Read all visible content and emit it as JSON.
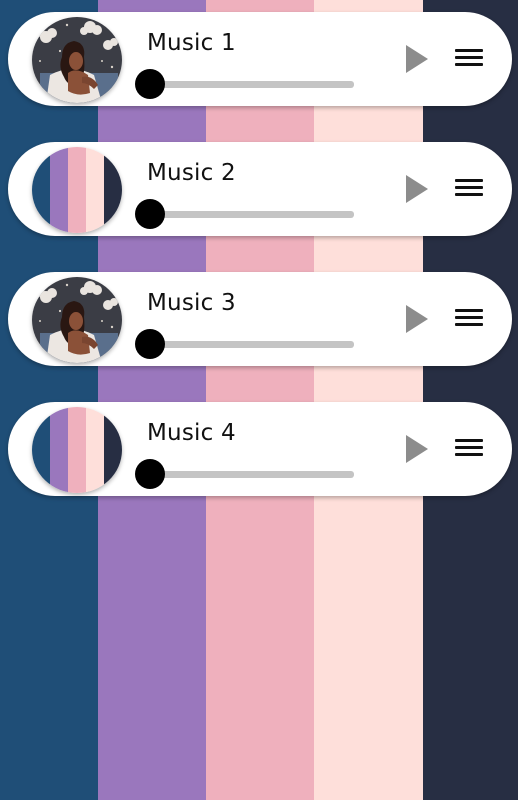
{
  "background": {
    "stripes": [
      "#1f4e77",
      "#9a77bd",
      "#efb0bd",
      "#fedfda",
      "#272e43"
    ]
  },
  "tracks": [
    {
      "title": "Music 1",
      "artwork": "illustration-art",
      "progress": 0,
      "play_icon": "play-icon",
      "menu_icon": "menu-icon"
    },
    {
      "title": "Music 2",
      "artwork": "stripes-art",
      "progress": 0,
      "play_icon": "play-icon",
      "menu_icon": "menu-icon"
    },
    {
      "title": "Music 3",
      "artwork": "illustration-art",
      "progress": 0,
      "play_icon": "play-icon",
      "menu_icon": "menu-icon"
    },
    {
      "title": "Music 4",
      "artwork": "stripes-art",
      "progress": 0,
      "play_icon": "play-icon",
      "menu_icon": "menu-icon"
    }
  ],
  "colors": {
    "card": "#ffffff",
    "play": "#8c8c8c",
    "track": "#c4c4c4",
    "knob": "#000000"
  }
}
